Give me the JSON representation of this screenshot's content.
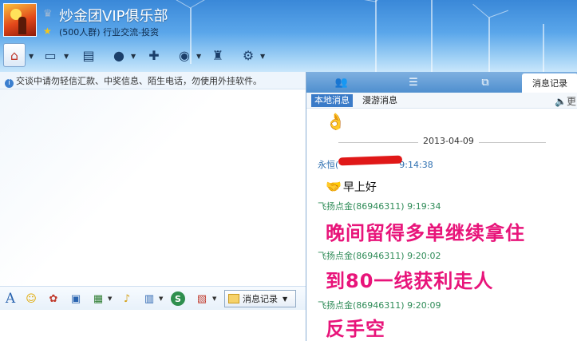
{
  "group": {
    "name": "炒金团VIP俱乐部",
    "info": "(500人群) 行业交流-投资"
  },
  "notice": "交谈中请勿轻信汇款、中奖信息、陌生电话，勿使用外挂软件。",
  "input_toolbar": {
    "history_label": "消息记录"
  },
  "right_panel": {
    "tabs": [
      "",
      "",
      "",
      "消息记录"
    ],
    "subtabs": {
      "local": "本地消息",
      "roaming": "漫游消息"
    },
    "speaker_text": "更",
    "messages": {
      "date": "2013-04-09",
      "first_sender_time": "9:14:38",
      "first_sender_prefix": "永恒(",
      "first_text": "早上好",
      "items": [
        {
          "sender": "飞扬点金(86946311) 9:19:34",
          "text": "晚间留得多单继续拿住"
        },
        {
          "sender": "飞扬点金(86946311) 9:20:02",
          "text": "到80一线获利走人"
        },
        {
          "sender": "飞扬点金(86946311) 9:20:09",
          "text": "反手空"
        }
      ]
    }
  },
  "icons": {
    "toolbar": [
      "home-icon",
      "folder-icon",
      "book-icon",
      "microphone-icon",
      "add-chat-icon",
      "webcam-icon",
      "police-icon",
      "gear-icon"
    ],
    "input": [
      "font-icon",
      "smile-icon",
      "gift-icon",
      "screenshot-icon",
      "image-icon",
      "music-icon",
      "scroll-icon",
      "s-icon",
      "poll-icon"
    ]
  },
  "colors": {
    "accent": "#3a7bc8",
    "message_big": "#e8147a",
    "sender": "#2e8b57"
  }
}
